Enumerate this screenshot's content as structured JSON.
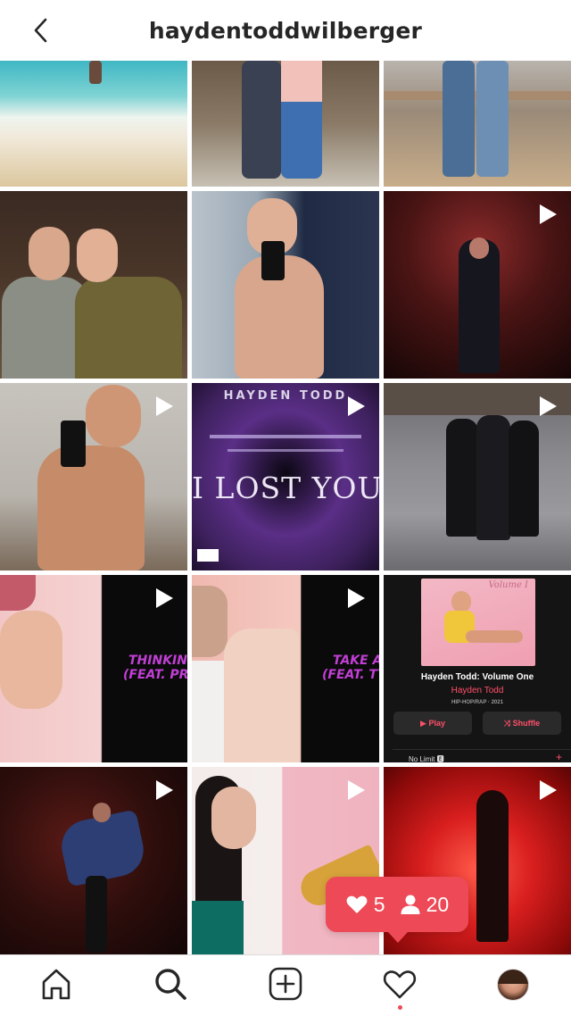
{
  "header": {
    "username": "haydentoddwilberger",
    "back_icon": "chevron-left-icon"
  },
  "grid": {
    "album_cover": {
      "top_text": "HAYDEN TODD",
      "title_text": "I LOST YOU"
    },
    "video_thinkin": {
      "line1": "THINKIN' O",
      "line2": "(FEAT. PRE"
    },
    "video_take": {
      "line1": "TAKE A",
      "line2": "(FEAT. TY"
    },
    "music_card": {
      "cover_text": "Volume I",
      "album_name": "Hayden Todd: Volume One",
      "artist": "Hayden Todd",
      "genre": "HIP-HOP/RAP · 2021",
      "play_label": "▶ Play",
      "shuffle_label": "⤨ Shuffle",
      "track": "No Limit 🅴",
      "add_symbol": "+"
    }
  },
  "activity": {
    "likes": "5",
    "followers": "20",
    "color": "#ed4956"
  },
  "tabbar": {
    "items": [
      "home-icon",
      "search-icon",
      "add-post-icon",
      "heart-icon",
      "profile-avatar"
    ]
  }
}
